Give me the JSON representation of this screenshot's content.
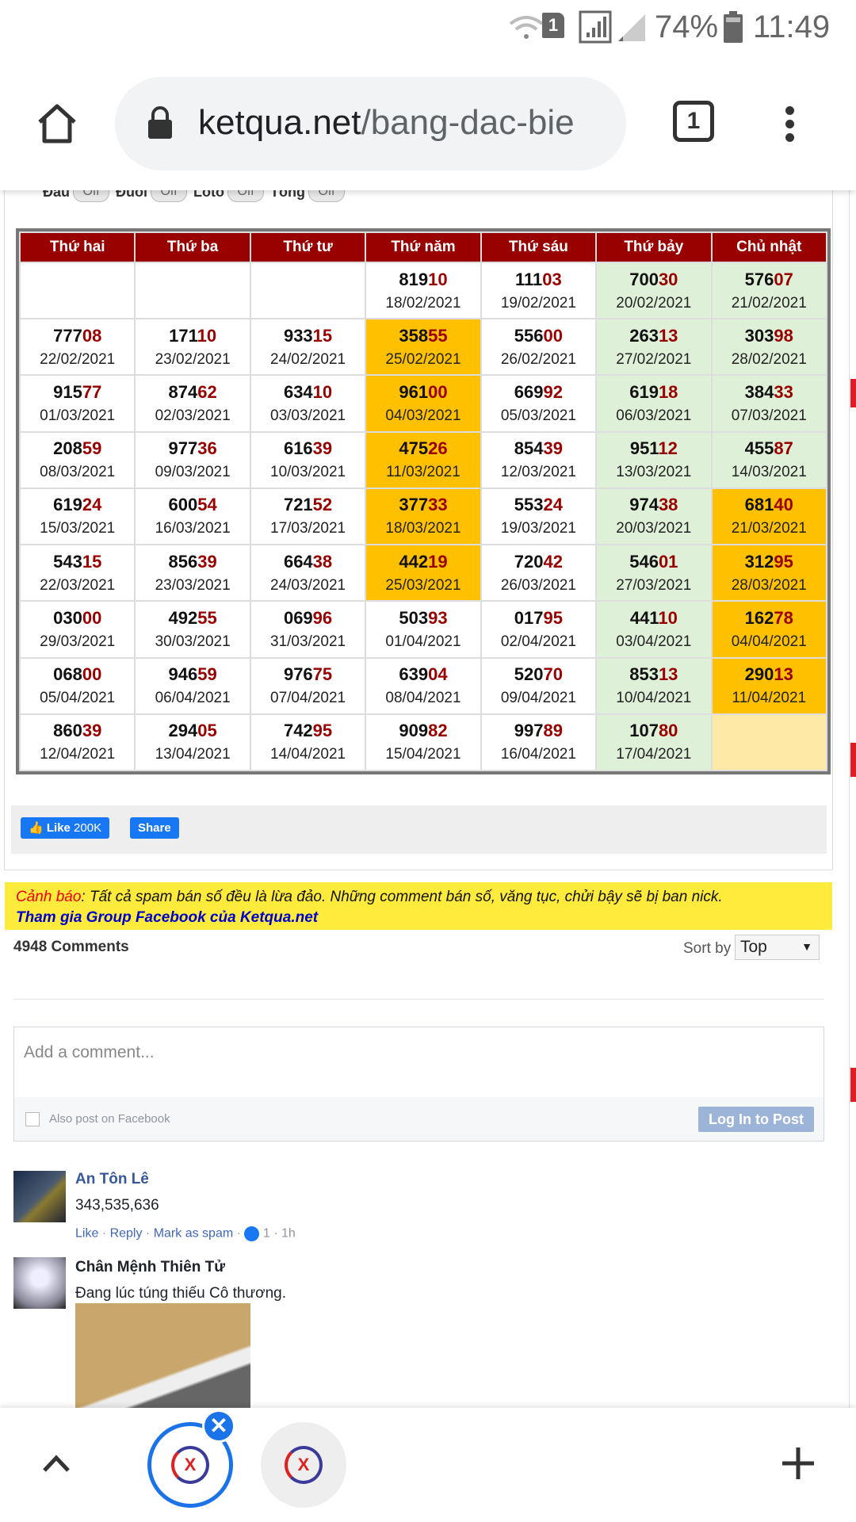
{
  "status_bar": {
    "battery": "74%",
    "time": "11:49",
    "sim": "1"
  },
  "browser": {
    "url_host": "ketqua.net",
    "url_path": "/bang-dac-bie",
    "tab_count": "1",
    "icons": [
      "home-icon",
      "lock-icon",
      "tab-switcher-icon",
      "more-vert-icon"
    ]
  },
  "toggles": [
    {
      "label": "Đầu",
      "state": "Off"
    },
    {
      "label": "Đuôi",
      "state": "Off"
    },
    {
      "label": "Loto",
      "state": "Off"
    },
    {
      "label": "Tổng",
      "state": "Off"
    }
  ],
  "table": {
    "headers": [
      "Thứ hai",
      "Thứ ba",
      "Thứ tư",
      "Thứ năm",
      "Thứ sáu",
      "Thứ bảy",
      "Chủ nhật"
    ],
    "colors": {
      "header": "#990000",
      "highlight_digits": "#990000",
      "green": "#dff0d8",
      "orange": "#ffc000",
      "pale": "#ffe9a6"
    },
    "rows": [
      [
        [
          "",
          "",
          "white"
        ],
        [
          "",
          "",
          "white"
        ],
        [
          "",
          "",
          "white"
        ],
        [
          "81910",
          "18/02/2021",
          "white"
        ],
        [
          "11103",
          "19/02/2021",
          "white"
        ],
        [
          "70030",
          "20/02/2021",
          "green"
        ],
        [
          "57607",
          "21/02/2021",
          "green"
        ]
      ],
      [
        [
          "77708",
          "22/02/2021",
          "white"
        ],
        [
          "17110",
          "23/02/2021",
          "white"
        ],
        [
          "93315",
          "24/02/2021",
          "white"
        ],
        [
          "35855",
          "25/02/2021",
          "orange"
        ],
        [
          "55600",
          "26/02/2021",
          "white"
        ],
        [
          "26313",
          "27/02/2021",
          "green"
        ],
        [
          "30398",
          "28/02/2021",
          "green"
        ]
      ],
      [
        [
          "91577",
          "01/03/2021",
          "white"
        ],
        [
          "87462",
          "02/03/2021",
          "white"
        ],
        [
          "63410",
          "03/03/2021",
          "white"
        ],
        [
          "96100",
          "04/03/2021",
          "orange"
        ],
        [
          "66992",
          "05/03/2021",
          "white"
        ],
        [
          "61918",
          "06/03/2021",
          "green"
        ],
        [
          "38433",
          "07/03/2021",
          "green"
        ]
      ],
      [
        [
          "20859",
          "08/03/2021",
          "white"
        ],
        [
          "97736",
          "09/03/2021",
          "white"
        ],
        [
          "61639",
          "10/03/2021",
          "white"
        ],
        [
          "47526",
          "11/03/2021",
          "orange"
        ],
        [
          "85439",
          "12/03/2021",
          "white"
        ],
        [
          "95112",
          "13/03/2021",
          "green"
        ],
        [
          "45587",
          "14/03/2021",
          "green"
        ]
      ],
      [
        [
          "61924",
          "15/03/2021",
          "white"
        ],
        [
          "60054",
          "16/03/2021",
          "white"
        ],
        [
          "72152",
          "17/03/2021",
          "white"
        ],
        [
          "37733",
          "18/03/2021",
          "orange"
        ],
        [
          "55324",
          "19/03/2021",
          "white"
        ],
        [
          "97438",
          "20/03/2021",
          "green"
        ],
        [
          "68140",
          "21/03/2021",
          "orange"
        ]
      ],
      [
        [
          "54315",
          "22/03/2021",
          "white"
        ],
        [
          "85639",
          "23/03/2021",
          "white"
        ],
        [
          "66438",
          "24/03/2021",
          "white"
        ],
        [
          "44219",
          "25/03/2021",
          "orange"
        ],
        [
          "72042",
          "26/03/2021",
          "white"
        ],
        [
          "54601",
          "27/03/2021",
          "green"
        ],
        [
          "31295",
          "28/03/2021",
          "orange"
        ]
      ],
      [
        [
          "03000",
          "29/03/2021",
          "white"
        ],
        [
          "49255",
          "30/03/2021",
          "white"
        ],
        [
          "06996",
          "31/03/2021",
          "white"
        ],
        [
          "50393",
          "01/04/2021",
          "white"
        ],
        [
          "01795",
          "02/04/2021",
          "white"
        ],
        [
          "44110",
          "03/04/2021",
          "green"
        ],
        [
          "16278",
          "04/04/2021",
          "orange"
        ]
      ],
      [
        [
          "06800",
          "05/04/2021",
          "white"
        ],
        [
          "94659",
          "06/04/2021",
          "white"
        ],
        [
          "97675",
          "07/04/2021",
          "white"
        ],
        [
          "63904",
          "08/04/2021",
          "white"
        ],
        [
          "52070",
          "09/04/2021",
          "white"
        ],
        [
          "85313",
          "10/04/2021",
          "green"
        ],
        [
          "29013",
          "11/04/2021",
          "orange"
        ]
      ],
      [
        [
          "86039",
          "12/04/2021",
          "white"
        ],
        [
          "29405",
          "13/04/2021",
          "white"
        ],
        [
          "74295",
          "14/04/2021",
          "white"
        ],
        [
          "90982",
          "15/04/2021",
          "white"
        ],
        [
          "99789",
          "16/04/2021",
          "white"
        ],
        [
          "10780",
          "17/04/2021",
          "green"
        ],
        [
          "",
          "",
          "pale"
        ]
      ]
    ]
  },
  "social": {
    "like_label": "Like",
    "like_count": "200K",
    "share_label": "Share"
  },
  "warning": {
    "label": "Cảnh báo",
    "text": ": Tất cả spam bán số đều là lừa đảo. Những comment bán số, văng tục, chửi bậy sẽ bị ban nick.",
    "link": "Tham gia Group Facebook của Ketqua.net"
  },
  "comments": {
    "count": "4948 Comments",
    "sort_label": "Sort by",
    "sort_value": "Top",
    "placeholder": "Add a comment...",
    "also_post": "Also post on Facebook",
    "login_button": "Log In to Post",
    "items": [
      {
        "name": "An Tôn Lê",
        "text": "343,535,636",
        "like": "Like",
        "reply": "Reply",
        "spam": "Mark as spam",
        "reactions": "1",
        "time": "1h"
      },
      {
        "name": "Chân Mệnh Thiên Tử",
        "text": "Đang lúc túng thiếu Cô thương."
      }
    ]
  },
  "bottom_bar": {
    "icons": [
      "chevron-up-icon",
      "tab-close-icon",
      "add-tab-icon"
    ]
  }
}
